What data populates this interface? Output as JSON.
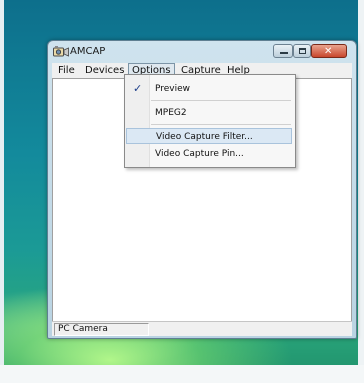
{
  "window": {
    "title": "AMCAP"
  },
  "menubar": {
    "items": [
      "File",
      "Devices",
      "Options",
      "Capture",
      "Help"
    ],
    "active": "Options"
  },
  "options_menu": {
    "items": [
      {
        "label": "Preview",
        "checked": true
      },
      {
        "label": "MPEG2",
        "checked": false
      },
      {
        "label": "Video Capture Filter...",
        "checked": false
      },
      {
        "label": "Video Capture Pin...",
        "checked": false
      }
    ],
    "check_glyph": "✓",
    "highlighted": "Video Capture Filter..."
  },
  "statusbar": {
    "text": "PC Camera"
  },
  "icons": {
    "app": "camera-icon",
    "minimize": "minimize-icon",
    "maximize": "maximize-icon",
    "close": "close-icon"
  },
  "colors": {
    "close_button": "#c8462d",
    "highlight": "#dbe8f4",
    "desktop": "#138a9c"
  }
}
